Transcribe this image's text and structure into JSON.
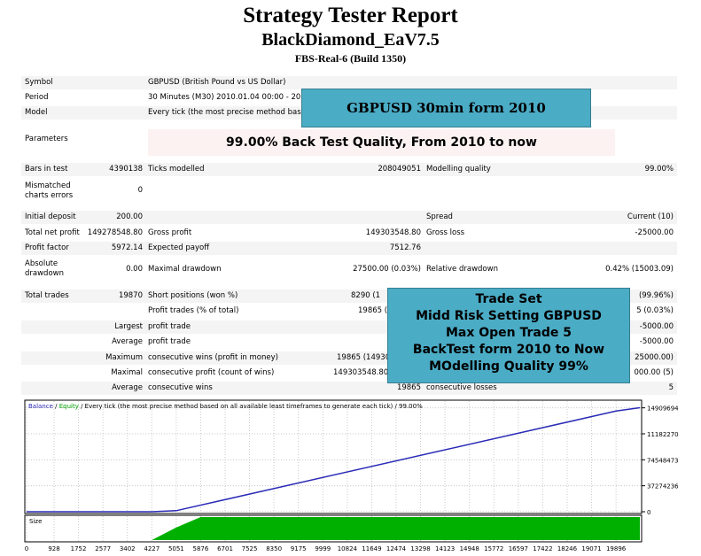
{
  "header": {
    "title": "Strategy Tester Report",
    "ea_name": "BlackDiamond_EaV7.5",
    "server": "FBS-Real-6 (Build 1350)"
  },
  "info": {
    "symbol_label": "Symbol",
    "symbol_value": "GBPUSD (British Pound vs US Dollar)",
    "period_label": "Period",
    "period_value": "30 Minutes (M30) 2010.01.04 00:00 - 20",
    "model_label": "Model",
    "model_value": "Every tick (the most precise method base",
    "parameters_label": "Parameters"
  },
  "banners": {
    "top": "GBPUSD 30min form 2010",
    "quality": "99.00% Back Test Quality, From 2010 to now",
    "trade_set": [
      "Trade Set",
      "Midd Risk Setting GBPUSD",
      "Max Open Trade 5",
      "BackTest form 2010 to Now",
      "MOdelling Quality 99%"
    ]
  },
  "stats": {
    "bars_label": "Bars in test",
    "bars_value": "4390138",
    "ticks_label": "Ticks modelled",
    "ticks_value": "208049051",
    "mq_label": "Modelling quality",
    "mq_value": "99.00%",
    "mismatch_label_1": "Mismatched",
    "mismatch_label_2": "charts errors",
    "mismatch_value": "0",
    "deposit_label": "Initial deposit",
    "deposit_value": "200.00",
    "spread_label": "Spread",
    "spread_value": "Current (10)",
    "netprofit_label": "Total net profit",
    "netprofit_value": "149278548.80",
    "grossprofit_label": "Gross profit",
    "grossprofit_value": "149303548.80",
    "grossloss_label": "Gross loss",
    "grossloss_value": "-25000.00",
    "pf_label": "Profit factor",
    "pf_value": "5972.14",
    "ep_label": "Expected payoff",
    "ep_value": "7512.76",
    "absdd_label_1": "Absolute",
    "absdd_label_2": "drawdown",
    "absdd_value": "0.00",
    "maxdd_label": "Maximal drawdown",
    "maxdd_value": "27500.00 (0.03%)",
    "reldd_label": "Relative drawdown",
    "reldd_value": "0.42% (15003.09)",
    "trades_label": "Total trades",
    "trades_value": "19870",
    "short_label": "Short positions (won %)",
    "short_value": "8290 (1",
    "long_value": "(99.96%)",
    "pt_label": "Profit trades (% of total)",
    "pt_value": "19865 (",
    "lt_value": "5 (0.03%)",
    "largest_label": "Largest",
    "lpt_label": "profit trade",
    "llt_value": "-5000.00",
    "average_label": "Average",
    "apt_label": "profit trade",
    "alt_value": "-5000.00",
    "maximum_label": "Maximum",
    "mcw_label": "consecutive wins (profit in money)",
    "mcw_value": "19865 (14930",
    "mcl_value": "25000.00)",
    "maximal_label": "Maximal",
    "mcp_label": "consecutive profit (count of wins)",
    "mcp_value": "149303548.80",
    "mcloss_value": "000.00 (5)",
    "average2_label": "Average",
    "acw_label": "consecutive wins",
    "acw_value": "19865",
    "acl_label": "consecutive losses",
    "acl_value": "5"
  },
  "chart_legend": {
    "balance": "Balance",
    "sep": " / ",
    "equity": "Equity",
    "rest": " / Every tick (the most precise method based on all available least timeframes to generate each tick) / 99.00%"
  },
  "chart_data": {
    "type": "line",
    "series": [
      {
        "name": "Balance",
        "color": "#2b2bb6",
        "x": [
          0,
          4227,
          5051,
          19896,
          20700
        ],
        "y": [
          200,
          200,
          1500000,
          144500000,
          149278548.8
        ]
      }
    ],
    "ylim": [
      0,
      155000000
    ],
    "xlim": [
      0,
      20700
    ],
    "y_ticks": [
      "0",
      "37274236",
      "74548473",
      "111822709",
      "149096946"
    ],
    "y_tick_labels": [
      "0",
      "37274236",
      "74548473",
      "11182270",
      "14909694"
    ],
    "x_tick_labels": [
      "0",
      "928",
      "1752",
      "2577",
      "3402",
      "4227",
      "5051",
      "5876",
      "6701",
      "7525",
      "8350",
      "9175",
      "9999",
      "10824",
      "11649",
      "12474",
      "13298",
      "14123",
      "14948",
      "15772",
      "16597",
      "17422",
      "18246",
      "19071",
      "19896"
    ],
    "size_label": "Size",
    "size_chart": {
      "type": "area",
      "color": "#00b000",
      "x": [
        0,
        4227,
        5051,
        5876,
        19896,
        20700
      ],
      "y": [
        0,
        0,
        0.55,
        1,
        1,
        1
      ]
    }
  }
}
